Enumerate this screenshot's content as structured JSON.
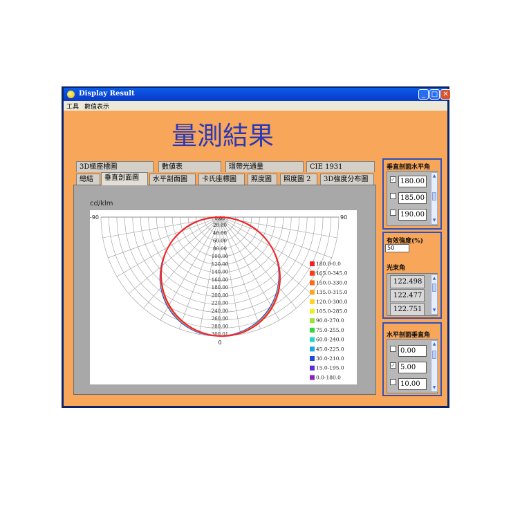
{
  "window": {
    "title": "Display Result",
    "controls": [
      "_",
      "□",
      "✕"
    ]
  },
  "menu": [
    "工具",
    "數值表示"
  ],
  "heading": "量測結果",
  "tabs_back": [
    "3D極座標圖",
    "數値表",
    "環帶光通量",
    "CIE 1931"
  ],
  "tabs_front": [
    "總結",
    "垂直剖面圖",
    "水平剖面圖",
    "卡氏座標圖",
    "照度圖",
    "照度圖 2",
    "3D強度分布圖"
  ],
  "active_tab": "垂直剖面圖",
  "chart_unit": "cd/klm",
  "chart_data": {
    "type": "polar",
    "angle_labels": {
      "left": "-90",
      "right": "90",
      "bottom": "0"
    },
    "radial_ticks": [
      "0.00",
      "20.00",
      "40.00",
      "60.00",
      "80.00",
      "100.00",
      "120.00",
      "140.00",
      "160.00",
      "180.00",
      "200.00",
      "220.00",
      "240.00",
      "260.00",
      "280.00",
      "300.01"
    ],
    "r_max": 300.01,
    "series": [
      {
        "name": "180.0-0.0",
        "color": "#ff1d1d"
      },
      {
        "name": "165.0-345.0",
        "color": "#ff3a16"
      },
      {
        "name": "150.0-330.0",
        "color": "#ff6a15"
      },
      {
        "name": "135.0-315.0",
        "color": "#ffa41c"
      },
      {
        "name": "120.0-300.0",
        "color": "#ffd21e"
      },
      {
        "name": "105.0-285.0",
        "color": "#f2ee24"
      },
      {
        "name": "90.0-270.0",
        "color": "#9be52e"
      },
      {
        "name": "75.0-255.0",
        "color": "#36d63a"
      },
      {
        "name": "60.0-240.0",
        "color": "#1fd6c9"
      },
      {
        "name": "45.0-225.0",
        "color": "#19a6e8"
      },
      {
        "name": "30.0-210.0",
        "color": "#1f48e0"
      },
      {
        "name": "15.0-195.0",
        "color": "#5a2ee0"
      },
      {
        "name": "0.0-180.0",
        "color": "#8a22c8"
      }
    ]
  },
  "vertical_group": {
    "title": "垂直剖面水平角",
    "items": [
      {
        "value": "180.00",
        "checked": true
      },
      {
        "value": "185.00",
        "checked": false
      },
      {
        "value": "190.00",
        "checked": false
      }
    ]
  },
  "effective": {
    "title": "有效強度(%)",
    "value": "50"
  },
  "flux": {
    "title": "光束角",
    "values": [
      "122.498",
      "122.477",
      "122.751"
    ]
  },
  "horizontal_group": {
    "title": "水平剖面垂直角",
    "items": [
      {
        "value": "0.00",
        "checked": false
      },
      {
        "value": "5.00",
        "checked": true
      },
      {
        "value": "10.00",
        "checked": false
      }
    ]
  }
}
